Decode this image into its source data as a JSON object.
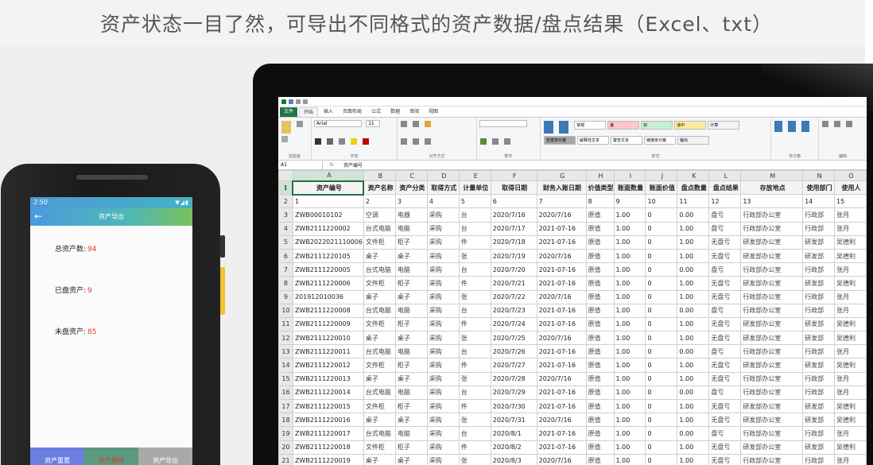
{
  "headline": "资产状态一目了然，可导出不同格式的资产数据/盘点结果（Excel、txt）",
  "excel": {
    "tabs": [
      "文件",
      "开始",
      "插入",
      "页面布局",
      "公式",
      "数据",
      "审阅",
      "视图"
    ],
    "active_tab": "开始",
    "name_box": "A1",
    "fx_label": "fx",
    "formula_value": "资产编号",
    "style_cells": [
      {
        "label": "常规",
        "bg": "#ffffff"
      },
      {
        "label": "差",
        "bg": "#ffc7ce"
      },
      {
        "label": "好",
        "bg": "#c6efce"
      },
      {
        "label": "适中",
        "bg": "#ffeb9c"
      },
      {
        "label": "计算",
        "bg": "#f2f2f2"
      },
      {
        "label": "检查单元格",
        "bg": "#a5a5a5"
      },
      {
        "label": "解释性文本",
        "bg": "#ffffff"
      },
      {
        "label": "警告文本",
        "bg": "#ffffff"
      },
      {
        "label": "链接单元格",
        "bg": "#ffffff"
      },
      {
        "label": "输出",
        "bg": "#f2f2f2"
      }
    ],
    "group_labels": [
      "剪贴板",
      "字体",
      "对齐方式",
      "数字",
      "样式",
      "单元格",
      "编辑"
    ],
    "font_name": "Arial",
    "font_size": "11",
    "columns": [
      "A",
      "B",
      "C",
      "D",
      "E",
      "F",
      "G",
      "H",
      "I",
      "J",
      "K",
      "L",
      "M",
      "N",
      "O"
    ],
    "header_row": [
      "资产编号",
      "资产名称",
      "资产分类",
      "取得方式",
      "计量单位",
      "取得日期",
      "财务入账日期",
      "价值类型",
      "账面数量",
      "账面价值",
      "盘点数量",
      "盘点结果",
      "存放地点",
      "使用部门",
      "使用人"
    ],
    "index_row": [
      "1",
      "2",
      "3",
      "4",
      "5",
      "6",
      "7",
      "8",
      "9",
      "10",
      "11",
      "12",
      "13",
      "14",
      "15",
      "16"
    ],
    "rows": [
      [
        "ZWB00010102",
        "空调",
        "电器",
        "采购",
        "台",
        "2020/7/16",
        "2020/7/16",
        "原值",
        "1.00",
        "0",
        "0.00",
        "盘亏",
        "行政部办公室",
        "行政部",
        "张月"
      ],
      [
        "ZWB2111220002",
        "台式电脑",
        "电脑",
        "采购",
        "台",
        "2020/7/17",
        "2021-07-16",
        "原值",
        "1.00",
        "0",
        "1.00",
        "盘亏",
        "行政部办公室",
        "行政部",
        "张月"
      ],
      [
        "ZWB2022021110006",
        "文件柜",
        "柜子",
        "采购",
        "件",
        "2020/7/18",
        "2021-07-16",
        "原值",
        "1.00",
        "0",
        "1.00",
        "无盘亏",
        "研发部办公室",
        "研发部",
        "吴德利"
      ],
      [
        "ZWB2111220105",
        "桌子",
        "桌子",
        "采购",
        "张",
        "2020/7/19",
        "2020/7/16",
        "原值",
        "1.00",
        "0",
        "1.00",
        "无盘亏",
        "研发部办公室",
        "研发部",
        "吴德利"
      ],
      [
        "ZWB2111220005",
        "台式电脑",
        "电脑",
        "采购",
        "台",
        "2020/7/20",
        "2021-07-16",
        "原值",
        "1.00",
        "0",
        "0.00",
        "盘亏",
        "行政部办公室",
        "行政部",
        "张月"
      ],
      [
        "ZWB2111220006",
        "文件柜",
        "柜子",
        "采购",
        "件",
        "2020/7/21",
        "2021-07-16",
        "原值",
        "1.00",
        "0",
        "1.00",
        "无盘亏",
        "研发部办公室",
        "研发部",
        "吴德利"
      ],
      [
        "201912010036",
        "桌子",
        "桌子",
        "采购",
        "张",
        "2020/7/22",
        "2020/7/16",
        "原值",
        "1.00",
        "0",
        "1.00",
        "无盘亏",
        "行政部办公室",
        "行政部",
        "张月"
      ],
      [
        "ZWB2111220008",
        "台式电脑",
        "电脑",
        "采购",
        "台",
        "2020/7/23",
        "2021-07-16",
        "原值",
        "1.00",
        "0",
        "0.00",
        "盘亏",
        "行政部办公室",
        "行政部",
        "张月"
      ],
      [
        "ZWB2111220009",
        "文件柜",
        "柜子",
        "采购",
        "件",
        "2020/7/24",
        "2021-07-16",
        "原值",
        "1.00",
        "0",
        "1.00",
        "无盘亏",
        "研发部办公室",
        "研发部",
        "吴德利"
      ],
      [
        "ZWB2111220010",
        "桌子",
        "桌子",
        "采购",
        "张",
        "2020/7/25",
        "2020/7/16",
        "原值",
        "1.00",
        "0",
        "1.00",
        "无盘亏",
        "研发部办公室",
        "研发部",
        "吴德利"
      ],
      [
        "ZWB2111220011",
        "台式电脑",
        "电脑",
        "采购",
        "台",
        "2020/7/26",
        "2021-07-16",
        "原值",
        "1.00",
        "0",
        "0.00",
        "盘亏",
        "行政部办公室",
        "行政部",
        "张月"
      ],
      [
        "ZWB2111220012",
        "文件柜",
        "柜子",
        "采购",
        "件",
        "2020/7/27",
        "2021-07-16",
        "原值",
        "1.00",
        "0",
        "1.00",
        "无盘亏",
        "研发部办公室",
        "研发部",
        "吴德利"
      ],
      [
        "ZWB2111220013",
        "桌子",
        "桌子",
        "采购",
        "张",
        "2020/7/28",
        "2020/7/16",
        "原值",
        "1.00",
        "0",
        "1.00",
        "无盘亏",
        "行政部办公室",
        "行政部",
        "张月"
      ],
      [
        "ZWB2111220014",
        "台式电脑",
        "电脑",
        "采购",
        "台",
        "2020/7/29",
        "2021-07-16",
        "原值",
        "1.00",
        "0",
        "0.00",
        "盘亏",
        "行政部办公室",
        "行政部",
        "张月"
      ],
      [
        "ZWB2111220015",
        "文件柜",
        "柜子",
        "采购",
        "件",
        "2020/7/30",
        "2021-07-16",
        "原值",
        "1.00",
        "0",
        "1.00",
        "无盘亏",
        "研发部办公室",
        "研发部",
        "吴德利"
      ],
      [
        "ZWB2111220016",
        "桌子",
        "桌子",
        "采购",
        "张",
        "2020/7/31",
        "2020/7/16",
        "原值",
        "1.00",
        "0",
        "1.00",
        "无盘亏",
        "研发部办公室",
        "研发部",
        "吴德利"
      ],
      [
        "ZWB2111220017",
        "台式电脑",
        "电脑",
        "采购",
        "台",
        "2020/8/1",
        "2021-07-16",
        "原值",
        "1.00",
        "0",
        "0.00",
        "盘亏",
        "行政部办公室",
        "行政部",
        "张月"
      ],
      [
        "ZWB2111220018",
        "文件柜",
        "柜子",
        "采购",
        "件",
        "2020/8/2",
        "2021-07-16",
        "原值",
        "1.00",
        "0",
        "1.00",
        "无盘亏",
        "研发部办公室",
        "研发部",
        "吴德利"
      ],
      [
        "ZWB2111220019",
        "桌子",
        "桌子",
        "采购",
        "张",
        "2020/8/3",
        "2020/7/16",
        "原值",
        "1.00",
        "0",
        "1.00",
        "无盘亏",
        "行政部办公室",
        "行政部",
        "张月"
      ]
    ]
  },
  "phone": {
    "time": "2:50",
    "status_icons": "▼◢▮",
    "back_icon": "arrow-left-icon",
    "title": "资产导出",
    "stats": [
      {
        "label": "总资产数:",
        "value": "94"
      },
      {
        "label": "已盘资产:",
        "value": "9"
      },
      {
        "label": "未盘资产:",
        "value": "85"
      }
    ],
    "buttons": [
      "资产重置",
      "资产删除",
      "资产导出"
    ]
  },
  "colors": {
    "excel_green": "#217346",
    "stat_red": "#e53935",
    "phone_btn_blue": "#6b7fe0",
    "phone_btn_green": "#5a9a7e",
    "phone_btn_gray": "#a9a9a9"
  }
}
